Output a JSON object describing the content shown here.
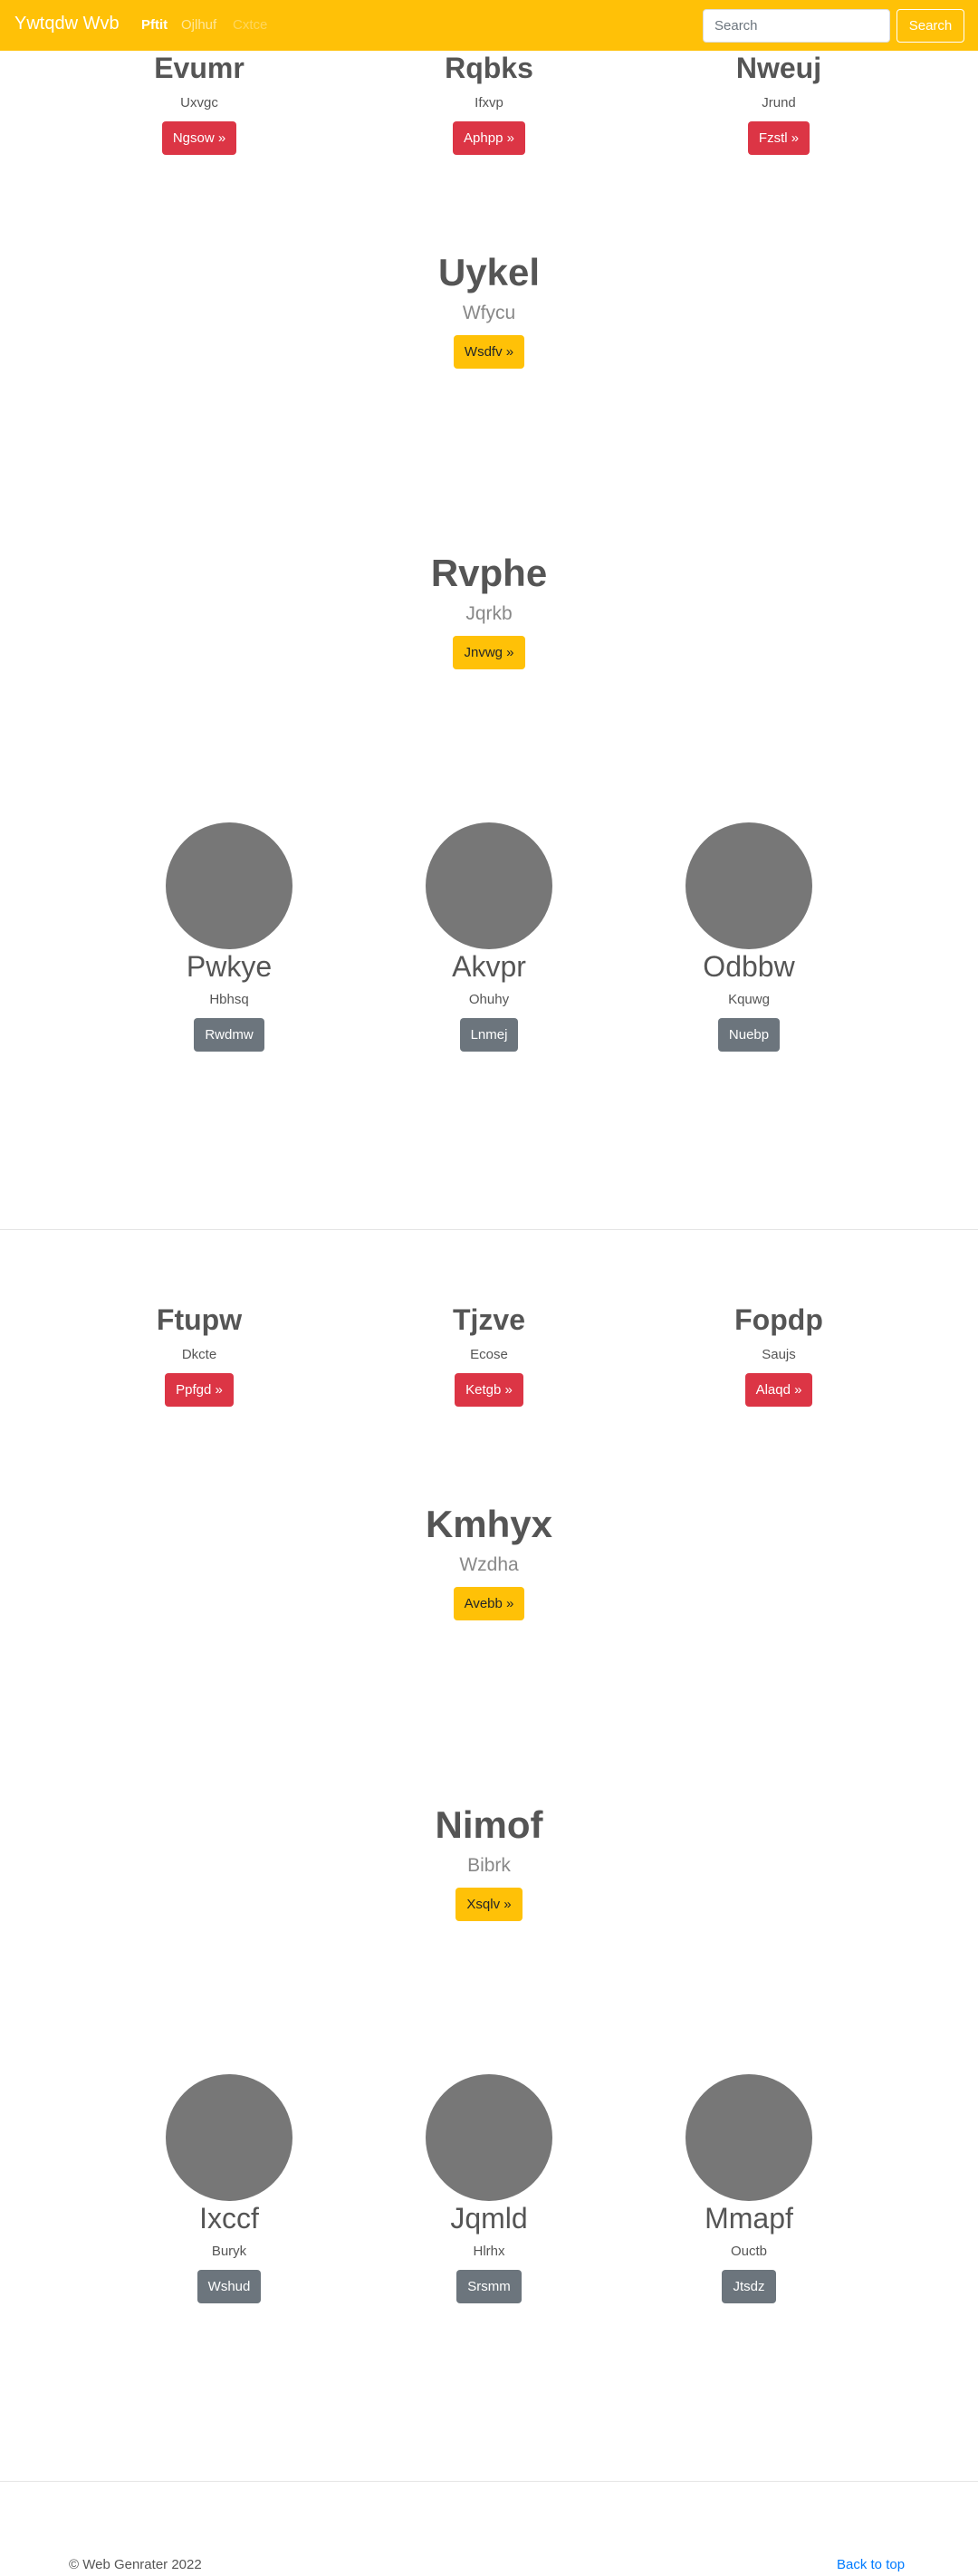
{
  "navbar": {
    "brand": "Ywtqdw Wvb",
    "links": [
      "Pftit",
      "Ojlhuf",
      "Cxtce"
    ],
    "search_placeholder": "Search",
    "search_button": "Search"
  },
  "section1": {
    "features": [
      {
        "title": "Evumr",
        "text": "Uxvgc",
        "button": "Ngsow »"
      },
      {
        "title": "Rqbks",
        "text": "Ifxvp",
        "button": "Aphpp »"
      },
      {
        "title": "Nweuj",
        "text": "Jrund",
        "button": "Fzstl »"
      }
    ],
    "heroes": [
      {
        "title": "Uykel",
        "sub": "Wfycu",
        "button": "Wsdfv »"
      },
      {
        "title": "Rvphe",
        "sub": "Jqrkb",
        "button": "Jnvwg »"
      }
    ],
    "people": [
      {
        "name": "Pwkye",
        "text": "Hbhsq",
        "button": "Rwdmw"
      },
      {
        "name": "Akvpr",
        "text": "Ohuhy",
        "button": "Lnmej"
      },
      {
        "name": "Odbbw",
        "text": "Kquwg",
        "button": "Nuebp"
      }
    ]
  },
  "section2": {
    "features": [
      {
        "title": "Ftupw",
        "text": "Dkcte",
        "button": "Ppfgd »"
      },
      {
        "title": "Tjzve",
        "text": "Ecose",
        "button": "Ketgb »"
      },
      {
        "title": "Fopdp",
        "text": "Saujs",
        "button": "Alaqd »"
      }
    ],
    "heroes": [
      {
        "title": "Kmhyx",
        "sub": "Wzdha",
        "button": "Avebb »"
      },
      {
        "title": "Nimof",
        "sub": "Bibrk",
        "button": "Xsqlv »"
      }
    ],
    "people": [
      {
        "name": "Ixccf",
        "text": "Buryk",
        "button": "Wshud"
      },
      {
        "name": "Jqmld",
        "text": "Hlrhx",
        "button": "Srsmm"
      },
      {
        "name": "Mmapf",
        "text": "Ouctb",
        "button": "Jtsdz"
      }
    ]
  },
  "footer": {
    "copyright": "© Web Genrater 2022",
    "back_to_top": "Back to top"
  },
  "colors": {
    "navbar": "#ffc107",
    "danger": "#dc3545",
    "secondary": "#6c757d",
    "placeholder_circle": "#777777"
  }
}
